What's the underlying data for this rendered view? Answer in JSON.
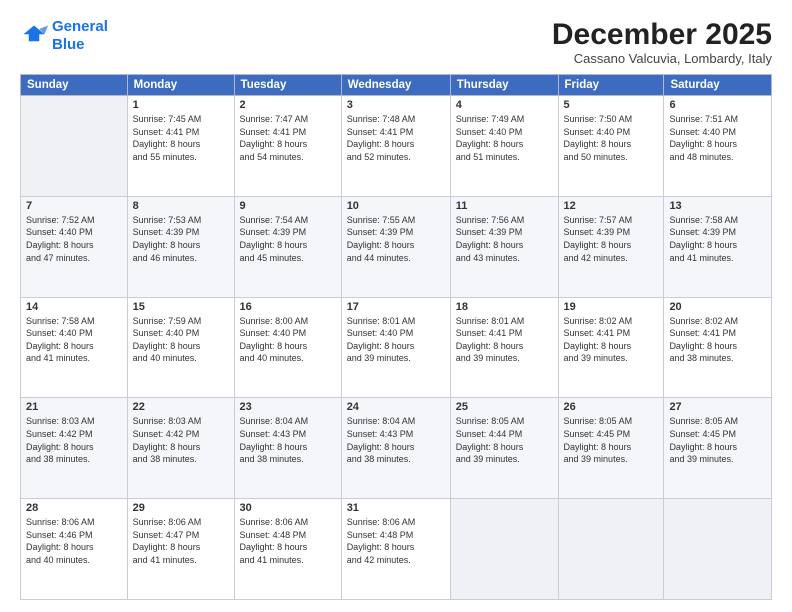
{
  "header": {
    "logo_line1": "General",
    "logo_line2": "Blue",
    "month": "December 2025",
    "location": "Cassano Valcuvia, Lombardy, Italy"
  },
  "days_of_week": [
    "Sunday",
    "Monday",
    "Tuesday",
    "Wednesday",
    "Thursday",
    "Friday",
    "Saturday"
  ],
  "weeks": [
    [
      {
        "day": "",
        "text": ""
      },
      {
        "day": "1",
        "text": "Sunrise: 7:45 AM\nSunset: 4:41 PM\nDaylight: 8 hours\nand 55 minutes."
      },
      {
        "day": "2",
        "text": "Sunrise: 7:47 AM\nSunset: 4:41 PM\nDaylight: 8 hours\nand 54 minutes."
      },
      {
        "day": "3",
        "text": "Sunrise: 7:48 AM\nSunset: 4:41 PM\nDaylight: 8 hours\nand 52 minutes."
      },
      {
        "day": "4",
        "text": "Sunrise: 7:49 AM\nSunset: 4:40 PM\nDaylight: 8 hours\nand 51 minutes."
      },
      {
        "day": "5",
        "text": "Sunrise: 7:50 AM\nSunset: 4:40 PM\nDaylight: 8 hours\nand 50 minutes."
      },
      {
        "day": "6",
        "text": "Sunrise: 7:51 AM\nSunset: 4:40 PM\nDaylight: 8 hours\nand 48 minutes."
      }
    ],
    [
      {
        "day": "7",
        "text": "Sunrise: 7:52 AM\nSunset: 4:40 PM\nDaylight: 8 hours\nand 47 minutes."
      },
      {
        "day": "8",
        "text": "Sunrise: 7:53 AM\nSunset: 4:39 PM\nDaylight: 8 hours\nand 46 minutes."
      },
      {
        "day": "9",
        "text": "Sunrise: 7:54 AM\nSunset: 4:39 PM\nDaylight: 8 hours\nand 45 minutes."
      },
      {
        "day": "10",
        "text": "Sunrise: 7:55 AM\nSunset: 4:39 PM\nDaylight: 8 hours\nand 44 minutes."
      },
      {
        "day": "11",
        "text": "Sunrise: 7:56 AM\nSunset: 4:39 PM\nDaylight: 8 hours\nand 43 minutes."
      },
      {
        "day": "12",
        "text": "Sunrise: 7:57 AM\nSunset: 4:39 PM\nDaylight: 8 hours\nand 42 minutes."
      },
      {
        "day": "13",
        "text": "Sunrise: 7:58 AM\nSunset: 4:39 PM\nDaylight: 8 hours\nand 41 minutes."
      }
    ],
    [
      {
        "day": "14",
        "text": "Sunrise: 7:58 AM\nSunset: 4:40 PM\nDaylight: 8 hours\nand 41 minutes."
      },
      {
        "day": "15",
        "text": "Sunrise: 7:59 AM\nSunset: 4:40 PM\nDaylight: 8 hours\nand 40 minutes."
      },
      {
        "day": "16",
        "text": "Sunrise: 8:00 AM\nSunset: 4:40 PM\nDaylight: 8 hours\nand 40 minutes."
      },
      {
        "day": "17",
        "text": "Sunrise: 8:01 AM\nSunset: 4:40 PM\nDaylight: 8 hours\nand 39 minutes."
      },
      {
        "day": "18",
        "text": "Sunrise: 8:01 AM\nSunset: 4:41 PM\nDaylight: 8 hours\nand 39 minutes."
      },
      {
        "day": "19",
        "text": "Sunrise: 8:02 AM\nSunset: 4:41 PM\nDaylight: 8 hours\nand 39 minutes."
      },
      {
        "day": "20",
        "text": "Sunrise: 8:02 AM\nSunset: 4:41 PM\nDaylight: 8 hours\nand 38 minutes."
      }
    ],
    [
      {
        "day": "21",
        "text": "Sunrise: 8:03 AM\nSunset: 4:42 PM\nDaylight: 8 hours\nand 38 minutes."
      },
      {
        "day": "22",
        "text": "Sunrise: 8:03 AM\nSunset: 4:42 PM\nDaylight: 8 hours\nand 38 minutes."
      },
      {
        "day": "23",
        "text": "Sunrise: 8:04 AM\nSunset: 4:43 PM\nDaylight: 8 hours\nand 38 minutes."
      },
      {
        "day": "24",
        "text": "Sunrise: 8:04 AM\nSunset: 4:43 PM\nDaylight: 8 hours\nand 38 minutes."
      },
      {
        "day": "25",
        "text": "Sunrise: 8:05 AM\nSunset: 4:44 PM\nDaylight: 8 hours\nand 39 minutes."
      },
      {
        "day": "26",
        "text": "Sunrise: 8:05 AM\nSunset: 4:45 PM\nDaylight: 8 hours\nand 39 minutes."
      },
      {
        "day": "27",
        "text": "Sunrise: 8:05 AM\nSunset: 4:45 PM\nDaylight: 8 hours\nand 39 minutes."
      }
    ],
    [
      {
        "day": "28",
        "text": "Sunrise: 8:06 AM\nSunset: 4:46 PM\nDaylight: 8 hours\nand 40 minutes."
      },
      {
        "day": "29",
        "text": "Sunrise: 8:06 AM\nSunset: 4:47 PM\nDaylight: 8 hours\nand 41 minutes."
      },
      {
        "day": "30",
        "text": "Sunrise: 8:06 AM\nSunset: 4:48 PM\nDaylight: 8 hours\nand 41 minutes."
      },
      {
        "day": "31",
        "text": "Sunrise: 8:06 AM\nSunset: 4:48 PM\nDaylight: 8 hours\nand 42 minutes."
      },
      {
        "day": "",
        "text": ""
      },
      {
        "day": "",
        "text": ""
      },
      {
        "day": "",
        "text": ""
      }
    ]
  ]
}
